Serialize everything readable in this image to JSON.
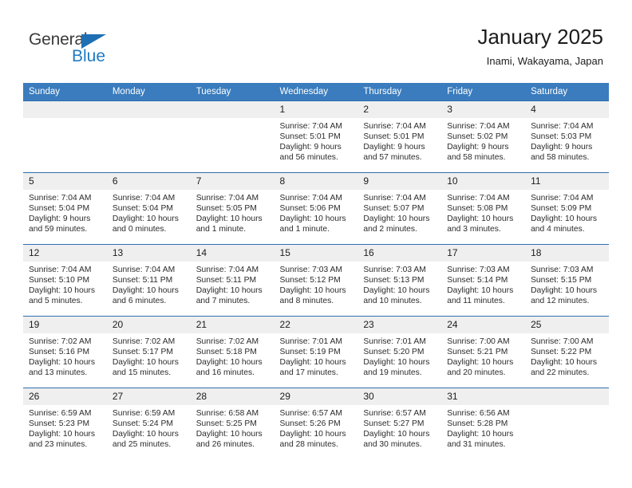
{
  "brand": {
    "name_part1": "General",
    "name_part2": "Blue",
    "color_primary": "#1f7bc4",
    "color_text": "#3b3b3b"
  },
  "header": {
    "title": "January 2025",
    "subtitle": "Inami, Wakayama, Japan"
  },
  "theme": {
    "header_row_bg": "#3a7cbd",
    "row_separator": "#2f6fae",
    "daynum_bg": "#efefef"
  },
  "weekday_headers": [
    "Sunday",
    "Monday",
    "Tuesday",
    "Wednesday",
    "Thursday",
    "Friday",
    "Saturday"
  ],
  "weeks": [
    [
      {
        "day": "",
        "blank": true
      },
      {
        "day": "",
        "blank": true
      },
      {
        "day": "",
        "blank": true
      },
      {
        "day": "1",
        "sunrise": "Sunrise: 7:04 AM",
        "sunset": "Sunset: 5:01 PM",
        "daylight_line1": "Daylight: 9 hours",
        "daylight_line2": "and 56 minutes."
      },
      {
        "day": "2",
        "sunrise": "Sunrise: 7:04 AM",
        "sunset": "Sunset: 5:01 PM",
        "daylight_line1": "Daylight: 9 hours",
        "daylight_line2": "and 57 minutes."
      },
      {
        "day": "3",
        "sunrise": "Sunrise: 7:04 AM",
        "sunset": "Sunset: 5:02 PM",
        "daylight_line1": "Daylight: 9 hours",
        "daylight_line2": "and 58 minutes."
      },
      {
        "day": "4",
        "sunrise": "Sunrise: 7:04 AM",
        "sunset": "Sunset: 5:03 PM",
        "daylight_line1": "Daylight: 9 hours",
        "daylight_line2": "and 58 minutes."
      }
    ],
    [
      {
        "day": "5",
        "sunrise": "Sunrise: 7:04 AM",
        "sunset": "Sunset: 5:04 PM",
        "daylight_line1": "Daylight: 9 hours",
        "daylight_line2": "and 59 minutes."
      },
      {
        "day": "6",
        "sunrise": "Sunrise: 7:04 AM",
        "sunset": "Sunset: 5:04 PM",
        "daylight_line1": "Daylight: 10 hours",
        "daylight_line2": "and 0 minutes."
      },
      {
        "day": "7",
        "sunrise": "Sunrise: 7:04 AM",
        "sunset": "Sunset: 5:05 PM",
        "daylight_line1": "Daylight: 10 hours",
        "daylight_line2": "and 1 minute."
      },
      {
        "day": "8",
        "sunrise": "Sunrise: 7:04 AM",
        "sunset": "Sunset: 5:06 PM",
        "daylight_line1": "Daylight: 10 hours",
        "daylight_line2": "and 1 minute."
      },
      {
        "day": "9",
        "sunrise": "Sunrise: 7:04 AM",
        "sunset": "Sunset: 5:07 PM",
        "daylight_line1": "Daylight: 10 hours",
        "daylight_line2": "and 2 minutes."
      },
      {
        "day": "10",
        "sunrise": "Sunrise: 7:04 AM",
        "sunset": "Sunset: 5:08 PM",
        "daylight_line1": "Daylight: 10 hours",
        "daylight_line2": "and 3 minutes."
      },
      {
        "day": "11",
        "sunrise": "Sunrise: 7:04 AM",
        "sunset": "Sunset: 5:09 PM",
        "daylight_line1": "Daylight: 10 hours",
        "daylight_line2": "and 4 minutes."
      }
    ],
    [
      {
        "day": "12",
        "sunrise": "Sunrise: 7:04 AM",
        "sunset": "Sunset: 5:10 PM",
        "daylight_line1": "Daylight: 10 hours",
        "daylight_line2": "and 5 minutes."
      },
      {
        "day": "13",
        "sunrise": "Sunrise: 7:04 AM",
        "sunset": "Sunset: 5:11 PM",
        "daylight_line1": "Daylight: 10 hours",
        "daylight_line2": "and 6 minutes."
      },
      {
        "day": "14",
        "sunrise": "Sunrise: 7:04 AM",
        "sunset": "Sunset: 5:11 PM",
        "daylight_line1": "Daylight: 10 hours",
        "daylight_line2": "and 7 minutes."
      },
      {
        "day": "15",
        "sunrise": "Sunrise: 7:03 AM",
        "sunset": "Sunset: 5:12 PM",
        "daylight_line1": "Daylight: 10 hours",
        "daylight_line2": "and 8 minutes."
      },
      {
        "day": "16",
        "sunrise": "Sunrise: 7:03 AM",
        "sunset": "Sunset: 5:13 PM",
        "daylight_line1": "Daylight: 10 hours",
        "daylight_line2": "and 10 minutes."
      },
      {
        "day": "17",
        "sunrise": "Sunrise: 7:03 AM",
        "sunset": "Sunset: 5:14 PM",
        "daylight_line1": "Daylight: 10 hours",
        "daylight_line2": "and 11 minutes."
      },
      {
        "day": "18",
        "sunrise": "Sunrise: 7:03 AM",
        "sunset": "Sunset: 5:15 PM",
        "daylight_line1": "Daylight: 10 hours",
        "daylight_line2": "and 12 minutes."
      }
    ],
    [
      {
        "day": "19",
        "sunrise": "Sunrise: 7:02 AM",
        "sunset": "Sunset: 5:16 PM",
        "daylight_line1": "Daylight: 10 hours",
        "daylight_line2": "and 13 minutes."
      },
      {
        "day": "20",
        "sunrise": "Sunrise: 7:02 AM",
        "sunset": "Sunset: 5:17 PM",
        "daylight_line1": "Daylight: 10 hours",
        "daylight_line2": "and 15 minutes."
      },
      {
        "day": "21",
        "sunrise": "Sunrise: 7:02 AM",
        "sunset": "Sunset: 5:18 PM",
        "daylight_line1": "Daylight: 10 hours",
        "daylight_line2": "and 16 minutes."
      },
      {
        "day": "22",
        "sunrise": "Sunrise: 7:01 AM",
        "sunset": "Sunset: 5:19 PM",
        "daylight_line1": "Daylight: 10 hours",
        "daylight_line2": "and 17 minutes."
      },
      {
        "day": "23",
        "sunrise": "Sunrise: 7:01 AM",
        "sunset": "Sunset: 5:20 PM",
        "daylight_line1": "Daylight: 10 hours",
        "daylight_line2": "and 19 minutes."
      },
      {
        "day": "24",
        "sunrise": "Sunrise: 7:00 AM",
        "sunset": "Sunset: 5:21 PM",
        "daylight_line1": "Daylight: 10 hours",
        "daylight_line2": "and 20 minutes."
      },
      {
        "day": "25",
        "sunrise": "Sunrise: 7:00 AM",
        "sunset": "Sunset: 5:22 PM",
        "daylight_line1": "Daylight: 10 hours",
        "daylight_line2": "and 22 minutes."
      }
    ],
    [
      {
        "day": "26",
        "sunrise": "Sunrise: 6:59 AM",
        "sunset": "Sunset: 5:23 PM",
        "daylight_line1": "Daylight: 10 hours",
        "daylight_line2": "and 23 minutes."
      },
      {
        "day": "27",
        "sunrise": "Sunrise: 6:59 AM",
        "sunset": "Sunset: 5:24 PM",
        "daylight_line1": "Daylight: 10 hours",
        "daylight_line2": "and 25 minutes."
      },
      {
        "day": "28",
        "sunrise": "Sunrise: 6:58 AM",
        "sunset": "Sunset: 5:25 PM",
        "daylight_line1": "Daylight: 10 hours",
        "daylight_line2": "and 26 minutes."
      },
      {
        "day": "29",
        "sunrise": "Sunrise: 6:57 AM",
        "sunset": "Sunset: 5:26 PM",
        "daylight_line1": "Daylight: 10 hours",
        "daylight_line2": "and 28 minutes."
      },
      {
        "day": "30",
        "sunrise": "Sunrise: 6:57 AM",
        "sunset": "Sunset: 5:27 PM",
        "daylight_line1": "Daylight: 10 hours",
        "daylight_line2": "and 30 minutes."
      },
      {
        "day": "31",
        "sunrise": "Sunrise: 6:56 AM",
        "sunset": "Sunset: 5:28 PM",
        "daylight_line1": "Daylight: 10 hours",
        "daylight_line2": "and 31 minutes."
      },
      {
        "day": "",
        "blank": true
      }
    ]
  ]
}
